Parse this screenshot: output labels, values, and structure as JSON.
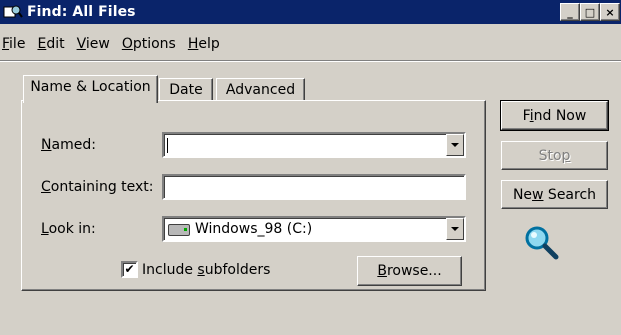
{
  "window": {
    "title": "Find: All Files",
    "controls": [
      "_",
      "□",
      "×"
    ]
  },
  "menu": {
    "items": [
      {
        "pre": "",
        "key": "F",
        "post": "ile"
      },
      {
        "pre": "",
        "key": "E",
        "post": "dit"
      },
      {
        "pre": "",
        "key": "V",
        "post": "iew"
      },
      {
        "pre": "",
        "key": "O",
        "post": "ptions"
      },
      {
        "pre": "",
        "key": "H",
        "post": "elp"
      }
    ]
  },
  "tabs": [
    {
      "label": "Name & Location",
      "active": true
    },
    {
      "label": "Date",
      "active": false
    },
    {
      "label": "Advanced",
      "active": false
    }
  ],
  "form": {
    "named": {
      "key": "N",
      "rest": "amed:",
      "value": ""
    },
    "containing": {
      "key": "C",
      "rest": "ontaining text:",
      "value": ""
    },
    "lookin": {
      "key": "L",
      "rest": "ook in:",
      "value": "Windows_98 (C:)"
    },
    "include": {
      "pre": "Include ",
      "key": "s",
      "post": "ubfolders",
      "checked": true,
      "mark": "✔"
    },
    "browse": {
      "key": "B",
      "rest": "rowse..."
    }
  },
  "actions": {
    "find_now": {
      "pre": "F",
      "key": "i",
      "post": "nd Now"
    },
    "stop": {
      "pre": "Sto",
      "key": "p",
      "post": ""
    },
    "new_search": {
      "pre": "Ne",
      "key": "w",
      "post": " Search"
    }
  },
  "colors": {
    "titlebar": "#0a246a",
    "face": "#d4d0c8",
    "disabled_text": "#808080"
  },
  "icons": [
    "find-files-icon",
    "magnifier-icon",
    "drive-icon",
    "dropdown-arrow-icon"
  ]
}
